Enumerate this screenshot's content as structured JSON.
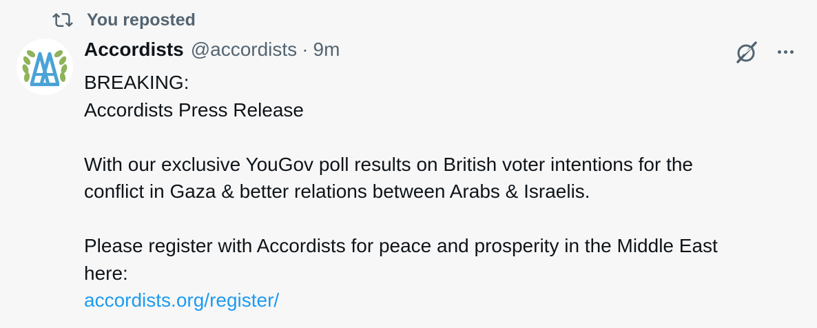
{
  "repost": {
    "icon": "repost-icon",
    "label": "You reposted"
  },
  "author": {
    "avatar_icon": "accordists-laurel-logo",
    "display_name": "Accordists",
    "handle": "@accordists",
    "separator": "·",
    "timestamp": "9m"
  },
  "actions": {
    "grok_icon": "grok-icon",
    "more_icon": "more-options-icon"
  },
  "post": {
    "lines": [
      "BREAKING:",
      "Accordists Press Release",
      "",
      "With our exclusive YouGov poll results on British voter intentions for the",
      "conflict in Gaza & better relations between Arabs & Israelis.",
      "",
      "Please register with Accordists for peace and prosperity in the Middle East",
      "here:"
    ],
    "link": "accordists.org/register/"
  },
  "colors": {
    "background": "#f7f7f7",
    "text": "#0f1419",
    "secondary": "#536471",
    "link": "#1d9bf0",
    "logo_blue": "#4aa3d6",
    "logo_green": "#8fb35a"
  }
}
